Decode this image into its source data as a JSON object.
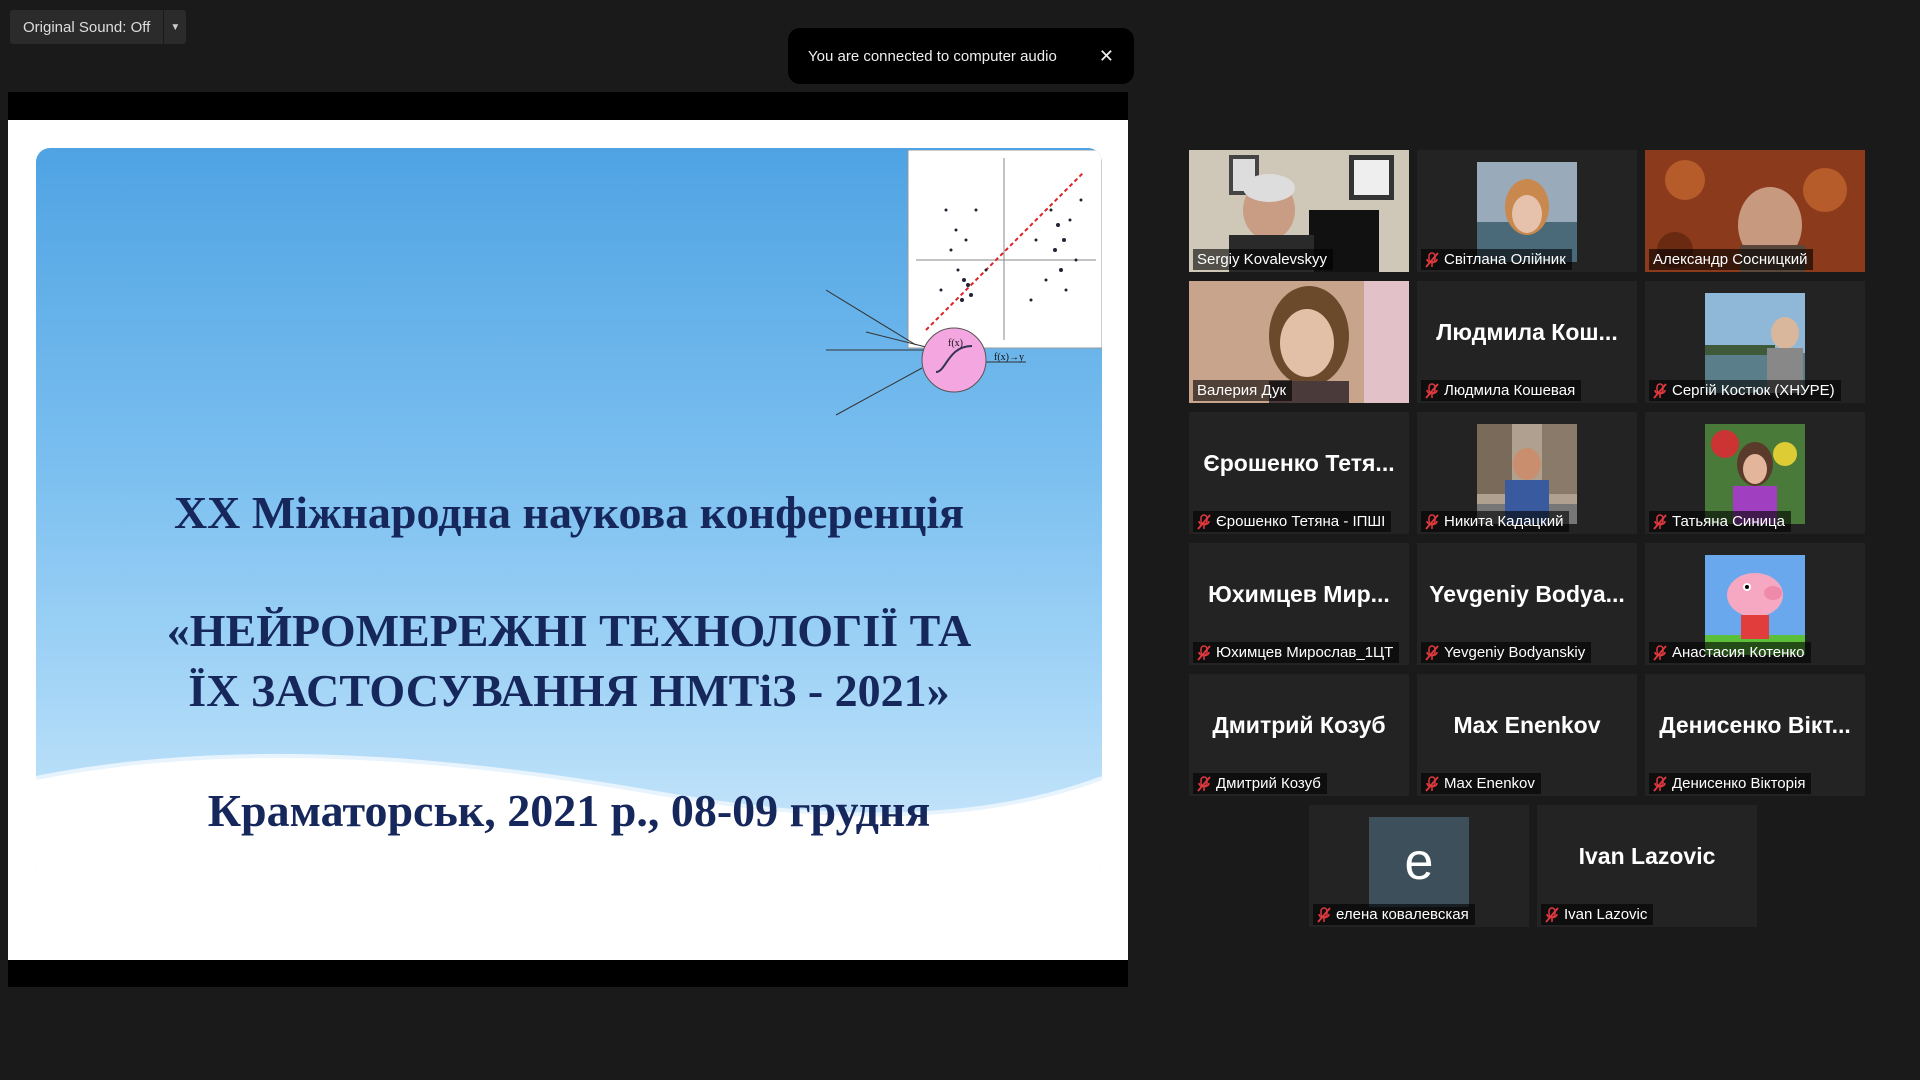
{
  "top": {
    "original_sound": "Original Sound: Off",
    "toast": "You are connected to computer audio",
    "toast_close": "✕"
  },
  "slide": {
    "line1": "XX Міжнародна наукова конференція",
    "line2": "«НЕЙРОМЕРЕЖНІ ТЕХНОЛОГІЇ ТА",
    "line3": "ЇХ ЗАСТОСУВАННЯ  НМТіЗ - 2021»",
    "line4": "Краматорськ, 2021 р.,  08-09 грудня"
  },
  "participants": [
    {
      "name": "Sergiy Kovalevskyy",
      "big": "",
      "muted": false,
      "video": "office"
    },
    {
      "name": "Світлана Олійник",
      "big": "",
      "muted": true,
      "video": "thumb-woman"
    },
    {
      "name": "Александр Сосницкий",
      "big": "",
      "muted": false,
      "video": "carpet"
    },
    {
      "name": "Валерия Дук",
      "big": "",
      "muted": false,
      "video": "woman"
    },
    {
      "name": "Людмила Кошевая",
      "big": "Людмила  Кош...",
      "muted": true,
      "video": ""
    },
    {
      "name": "Сергій Костюк (ХНУРЕ)",
      "big": "",
      "muted": true,
      "video": "thumb-river"
    },
    {
      "name": "Єрошенко Тетяна - ІПШІ",
      "big": "Єрошенко  Тетя...",
      "muted": true,
      "video": ""
    },
    {
      "name": "Никита Кадацкий",
      "big": "",
      "muted": true,
      "video": "thumb-man"
    },
    {
      "name": "Татьяна Синица",
      "big": "",
      "muted": true,
      "video": "thumb-garden"
    },
    {
      "name": "Юхимцев Мирослав_1ЦТ",
      "big": "Юхимцев  Мир...",
      "muted": true,
      "video": ""
    },
    {
      "name": "Yevgeniy Bodyanskiy",
      "big": "Yevgeniy  Bodya...",
      "muted": true,
      "video": ""
    },
    {
      "name": "Анастасия Котенко",
      "big": "",
      "muted": true,
      "video": "thumb-pig"
    },
    {
      "name": "Дмитрий Козуб",
      "big": "Дмитрий Козуб",
      "muted": true,
      "video": ""
    },
    {
      "name": "Max Enenkov",
      "big": "Max Enenkov",
      "muted": true,
      "video": ""
    },
    {
      "name": "Денисенко Вікторія",
      "big": "Денисенко  Вікт...",
      "muted": true,
      "video": ""
    },
    {
      "name": "елена ковалевская",
      "big": "",
      "muted": true,
      "video": "avatar-e",
      "avatar_letter": "e"
    },
    {
      "name": "Ivan Lazovic",
      "big": "Ivan Lazovic",
      "muted": true,
      "video": ""
    }
  ],
  "colors": {
    "active_border": "#b6d53d",
    "muted_icon": "#e0393e",
    "slide_text": "#16275c"
  }
}
